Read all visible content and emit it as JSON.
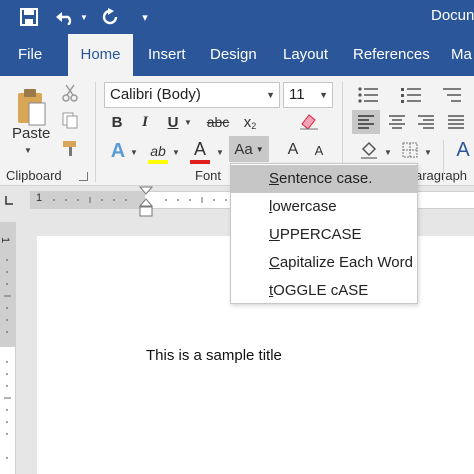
{
  "app": {
    "title": "Docun"
  },
  "quick_access": {
    "save_icon": "save-icon",
    "undo_icon": "undo-icon",
    "redo_icon": "redo-icon",
    "customize_icon": "customize-qat-icon"
  },
  "tabs": [
    "File",
    "Home",
    "Insert",
    "Design",
    "Layout",
    "References",
    "Ma"
  ],
  "active_tab": "Home",
  "ribbon": {
    "clipboard": {
      "paste_label": "Paste",
      "group_label": "Clipboard"
    },
    "font": {
      "font_name": "Calibri (Body)",
      "font_size": "11",
      "bold": "B",
      "italic": "I",
      "underline": "U",
      "strike": "abc",
      "subscript": "x",
      "sub2": "2",
      "text_effects": "A",
      "highlight": "ab",
      "font_color": "A",
      "change_case": "Aa",
      "grow": "A",
      "shrink": "A",
      "group_label": "Font"
    },
    "paragraph": {
      "group_label": "aragraph"
    },
    "styles": {
      "icon": "A"
    },
    "colors": {
      "accent": "#2b579a",
      "font_red": "#e0201e",
      "highlight_yellow": "#ffff00"
    }
  },
  "ruler": {
    "mark_1": "1"
  },
  "change_case_menu": {
    "items": [
      {
        "accel": "S",
        "rest": "entence case."
      },
      {
        "accel": "l",
        "rest": "owercase"
      },
      {
        "accel": "U",
        "rest": "PPERCASE"
      },
      {
        "accel": "C",
        "rest": "apitalize Each Word"
      },
      {
        "accel": "t",
        "rest": "OGGLE cASE"
      }
    ],
    "highlighted_index": 0
  },
  "document": {
    "text": "This is a sample title"
  }
}
